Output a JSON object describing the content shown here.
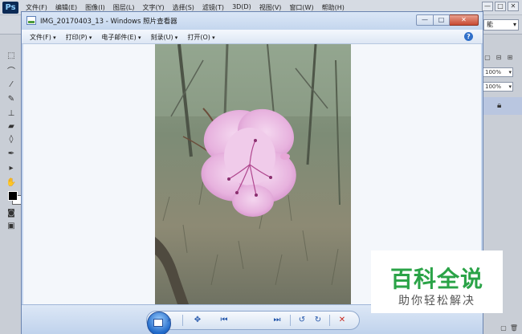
{
  "photoshop": {
    "logo": "Ps",
    "menu": [
      "文件(F)",
      "编辑(E)",
      "图像(I)",
      "图层(L)",
      "文字(Y)",
      "选择(S)",
      "滤镜(T)",
      "3D(D)",
      "视图(V)",
      "窗口(W)",
      "帮助(H)"
    ],
    "window_controls": {
      "minimize": "—",
      "restore": "□",
      "close": "✕"
    },
    "workspace_select": "能",
    "panel": {
      "opacity": "100%",
      "fill": "100%"
    }
  },
  "viewer": {
    "title": "IMG_20170403_13 - Windows 照片查看器",
    "window_controls": {
      "minimize": "—",
      "maximize": "□",
      "close": "✕"
    },
    "menu": [
      "文件(F)",
      "打印(P)",
      "电子邮件(E)",
      "刻录(U)",
      "打开(O)"
    ],
    "help": "?",
    "controls": {
      "zoom": "⌕",
      "fit": "✥",
      "prev": "⏮",
      "next": "⏭",
      "rotate_left": "↺",
      "rotate_right": "↻",
      "delete": "✕"
    }
  },
  "watermark": {
    "title": "百科全说",
    "subtitle": "助你轻松解决",
    "color": "#2aa347"
  }
}
